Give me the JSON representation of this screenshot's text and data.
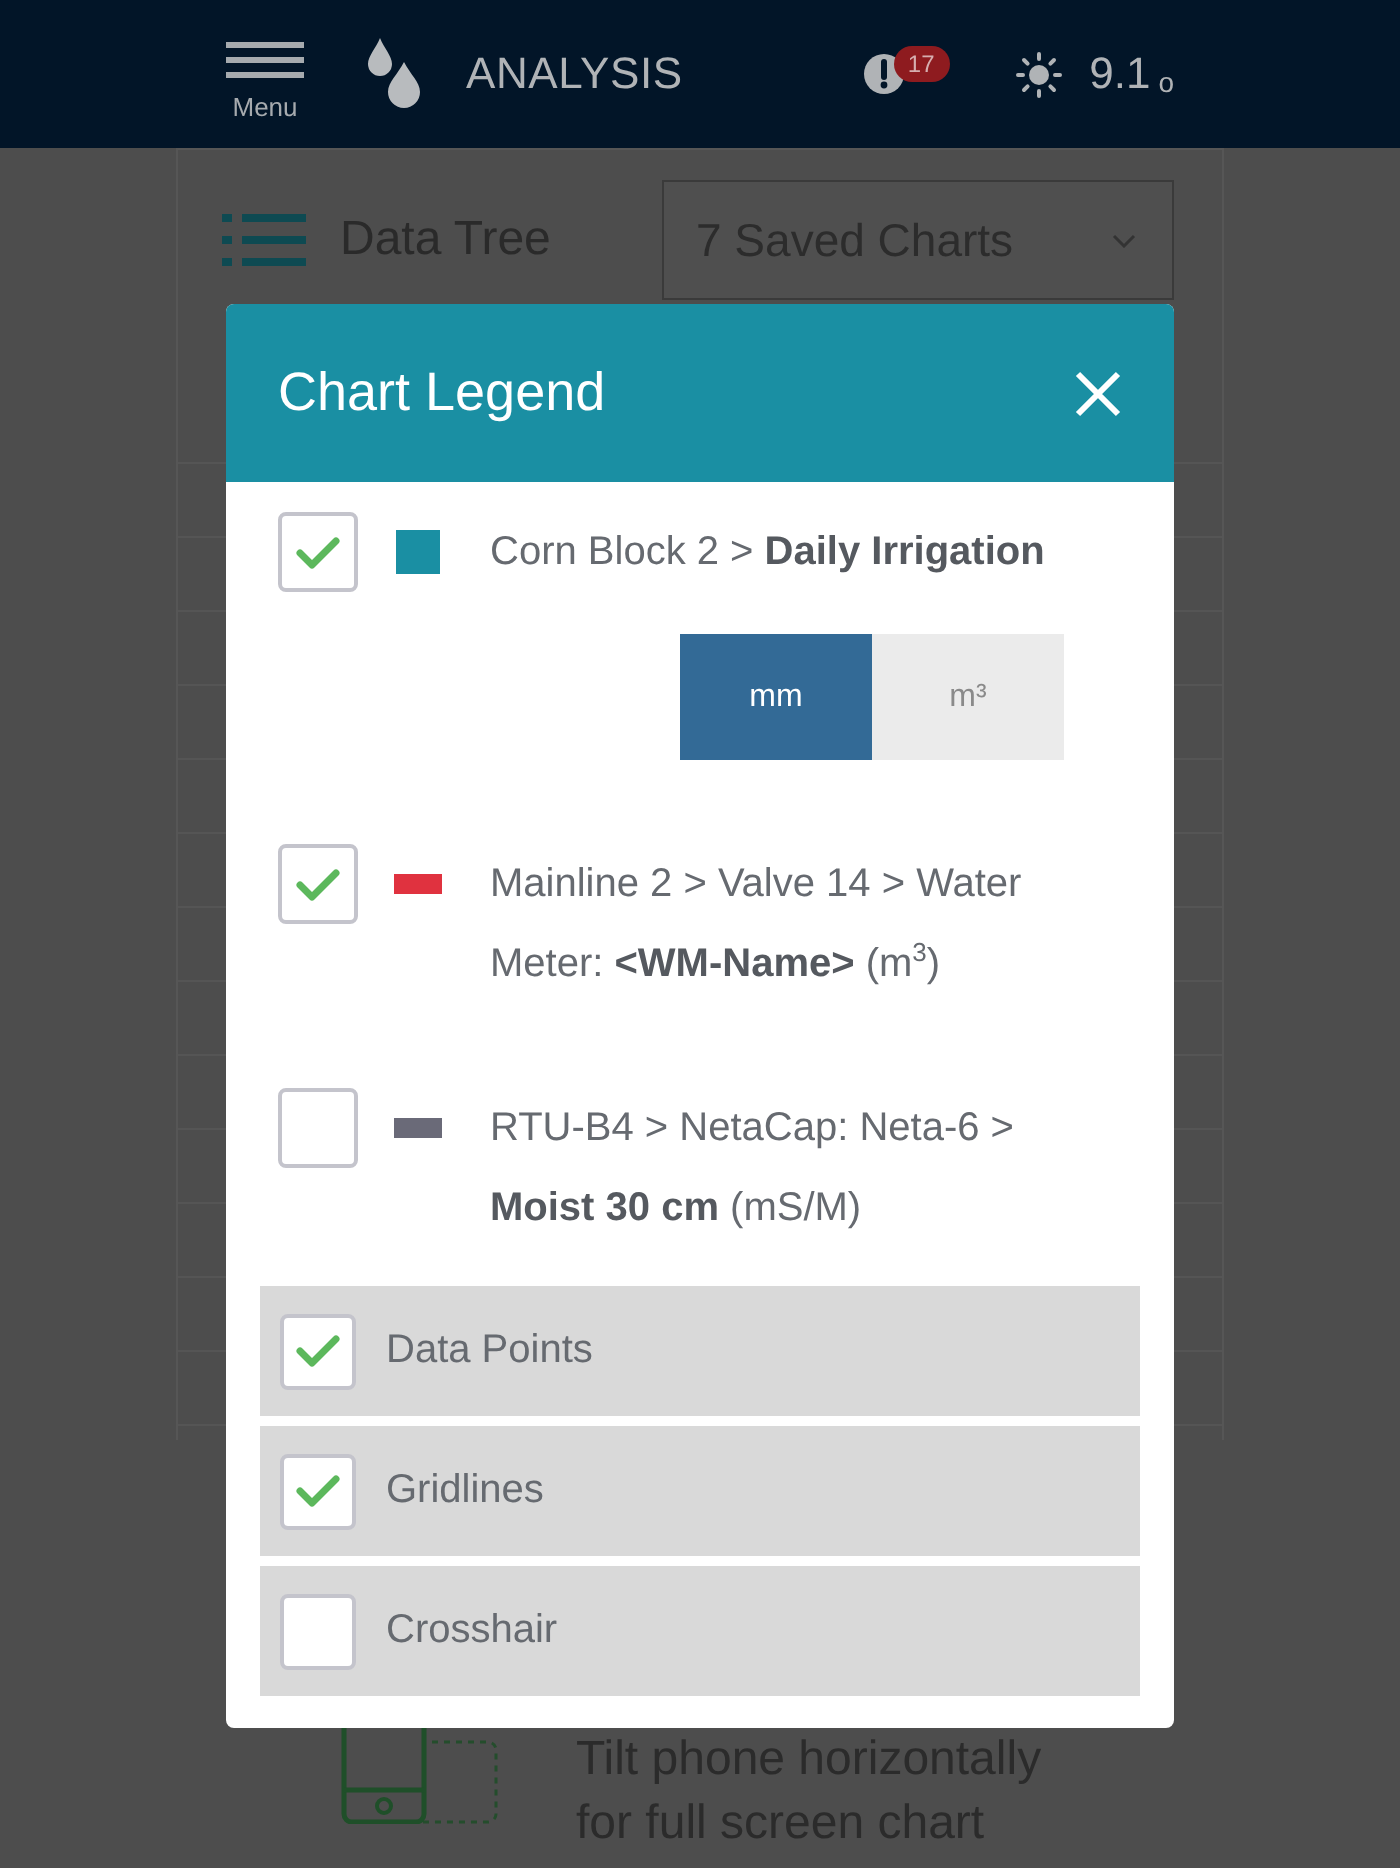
{
  "header": {
    "menu_label": "Menu",
    "title": "ANALYSIS",
    "alert_count": "17",
    "temperature": "9.1",
    "temperature_unit": "o"
  },
  "toolbar": {
    "data_tree_label": "Data Tree",
    "saved_charts": "7 Saved Charts"
  },
  "legend": {
    "title": "Chart Legend",
    "series": [
      {
        "kind": "bar",
        "checked": true,
        "color": "#1a8fa3",
        "label": "Corn Block 2 > **Daily Irrigation**",
        "units": [
          {
            "label": "mm",
            "selected": true
          },
          {
            "label": "m³",
            "selected": false
          }
        ]
      },
      {
        "kind": "line",
        "checked": true,
        "color": "#e0323f",
        "label": "Mainline 2 > Valve 14 > Water Meter: **<WM-Name>** (m$^{3}$)"
      },
      {
        "kind": "line",
        "checked": false,
        "color": "#6a6a78",
        "label": "RTU-B4 > NetaCap: Neta-6 > **Moist 30 cm** (mS/M)"
      }
    ],
    "options": [
      {
        "label": "Data Points",
        "checked": true
      },
      {
        "label": "Gridlines",
        "checked": true
      },
      {
        "label": "Crosshair",
        "checked": false
      }
    ]
  },
  "hint": {
    "lines": [
      "Tilt phone horizontally",
      "for full screen chart"
    ]
  }
}
